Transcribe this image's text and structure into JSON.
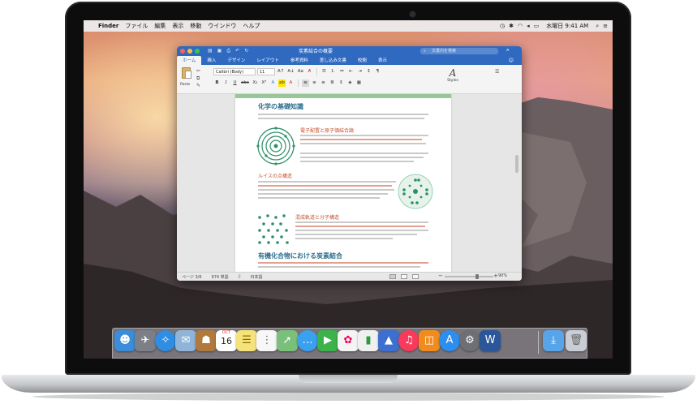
{
  "menubar": {
    "app": "Finder",
    "items": [
      "ファイル",
      "編集",
      "表示",
      "移動",
      "ウインドウ",
      "ヘルプ"
    ],
    "clock": "水曜日 9:41 AM"
  },
  "word": {
    "document_title": "炭素結合の概要",
    "search_placeholder": "文書内を検索",
    "tabs": [
      "ホーム",
      "挿入",
      "デザイン",
      "レイアウト",
      "参考資料",
      "差し込み文書",
      "校閲",
      "表示"
    ],
    "paste_label": "Paste",
    "font_name": "Calibri (Body)",
    "font_size": "11",
    "styles_label": "Styles",
    "format_buttons": [
      "B",
      "I",
      "U",
      "abc",
      "X₂",
      "X²"
    ],
    "document": {
      "heading_main": "化学の基礎知識",
      "section_1": "電子配置と原子価結合論",
      "section_2": "ルイスの点構造",
      "section_3": "混成軌道と分子構造",
      "heading_next": "有機化合物における炭素結合"
    },
    "status": {
      "page": "ページ 3/6",
      "words": "974 単語",
      "language": "日本語",
      "zoom": "90%",
      "zoom_level_fraction": 0.9
    }
  },
  "dock": {
    "icons": [
      "finder-icon",
      "launchpad-icon",
      "safari-icon",
      "mail-icon",
      "contacts-icon",
      "calendar-icon",
      "notes-icon",
      "reminders-icon",
      "maps-icon",
      "messages-icon",
      "facetime-icon",
      "photos-icon",
      "numbers-icon",
      "keynote-icon",
      "itunes-icon",
      "ibooks-icon",
      "app-store-icon",
      "system-preferences-icon",
      "word-icon",
      "downloads-icon",
      "trash-icon"
    ],
    "calendar_month": "OCT",
    "calendar_day": "16",
    "word_letter": "W"
  },
  "colors": {
    "word_blue": "#2f6ac0",
    "heading_blue": "#2e6f8e",
    "heading_orange": "#c5542e",
    "accent_green": "#98c79a"
  }
}
